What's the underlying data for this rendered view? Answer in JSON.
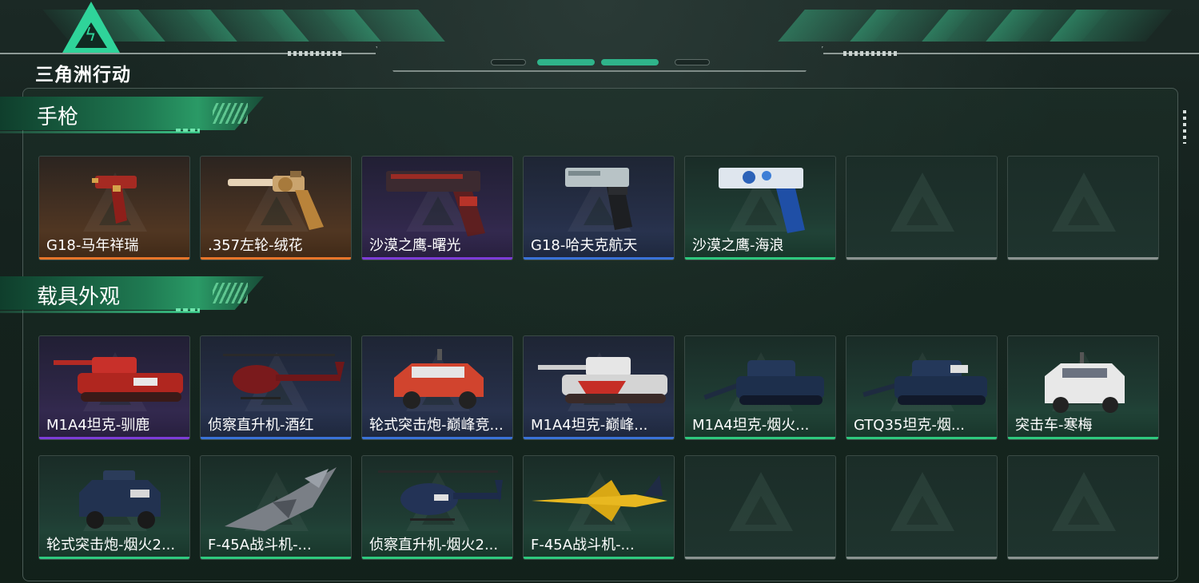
{
  "header": {
    "logo_text": "三角洲行动"
  },
  "sections": [
    {
      "title": "手枪",
      "rows": [
        [
          {
            "label": "G18-马年祥瑞",
            "rarity": "orange",
            "icon": "pistol-red-gold-icon"
          },
          {
            "label": ".357左轮-绒花",
            "rarity": "orange",
            "icon": "revolver-gold-icon"
          },
          {
            "label": "沙漠之鹰-曙光",
            "rarity": "purple",
            "icon": "desert-eagle-red-icon"
          },
          {
            "label": "G18-哈夫克航天",
            "rarity": "blue",
            "icon": "pistol-black-icon"
          },
          {
            "label": "沙漠之鹰-海浪",
            "rarity": "green",
            "icon": "desert-eagle-blue-icon"
          },
          {
            "label": "",
            "rarity": "empty",
            "icon": "empty-slot-icon"
          },
          {
            "label": "",
            "rarity": "empty",
            "icon": "empty-slot-icon"
          }
        ]
      ]
    },
    {
      "title": "载具外观",
      "rows": [
        [
          {
            "label": "M1A4坦克-驯鹿",
            "rarity": "purple",
            "icon": "tank-red-icon"
          },
          {
            "label": "侦察直升机-酒红",
            "rarity": "blue",
            "icon": "helicopter-red-icon"
          },
          {
            "label": "轮式突击炮-巅峰竞...",
            "rarity": "blue",
            "icon": "armored-car-red-icon"
          },
          {
            "label": "M1A4坦克-巅峰...",
            "rarity": "blue",
            "icon": "tank-red-white-icon"
          },
          {
            "label": "M1A4坦克-烟火...",
            "rarity": "green",
            "icon": "tank-navy-icon"
          },
          {
            "label": "GTQ35坦克-烟...",
            "rarity": "green",
            "icon": "tank-navy-2025-icon"
          },
          {
            "label": "突击车-寒梅",
            "rarity": "green",
            "icon": "assault-vehicle-white-icon"
          }
        ],
        [
          {
            "label": "轮式突击炮-烟火2...",
            "rarity": "green",
            "icon": "armored-car-navy-icon"
          },
          {
            "label": "F-45A战斗机-...",
            "rarity": "green",
            "icon": "fighter-jet-camo-icon"
          },
          {
            "label": "侦察直升机-烟火2...",
            "rarity": "green",
            "icon": "helicopter-navy-icon"
          },
          {
            "label": "F-45A战斗机-...",
            "rarity": "green",
            "icon": "fighter-jet-yellow-icon"
          },
          {
            "label": "",
            "rarity": "empty",
            "icon": "empty-slot-icon"
          },
          {
            "label": "",
            "rarity": "empty",
            "icon": "empty-slot-icon"
          },
          {
            "label": "",
            "rarity": "empty",
            "icon": "empty-slot-icon"
          }
        ]
      ]
    }
  ],
  "colors": {
    "orange": "#e8752a",
    "purple": "#7d3cd8",
    "blue": "#3a72d8",
    "green": "#2ec97e",
    "empty": "#8a9390",
    "accent": "#2fd49a"
  }
}
